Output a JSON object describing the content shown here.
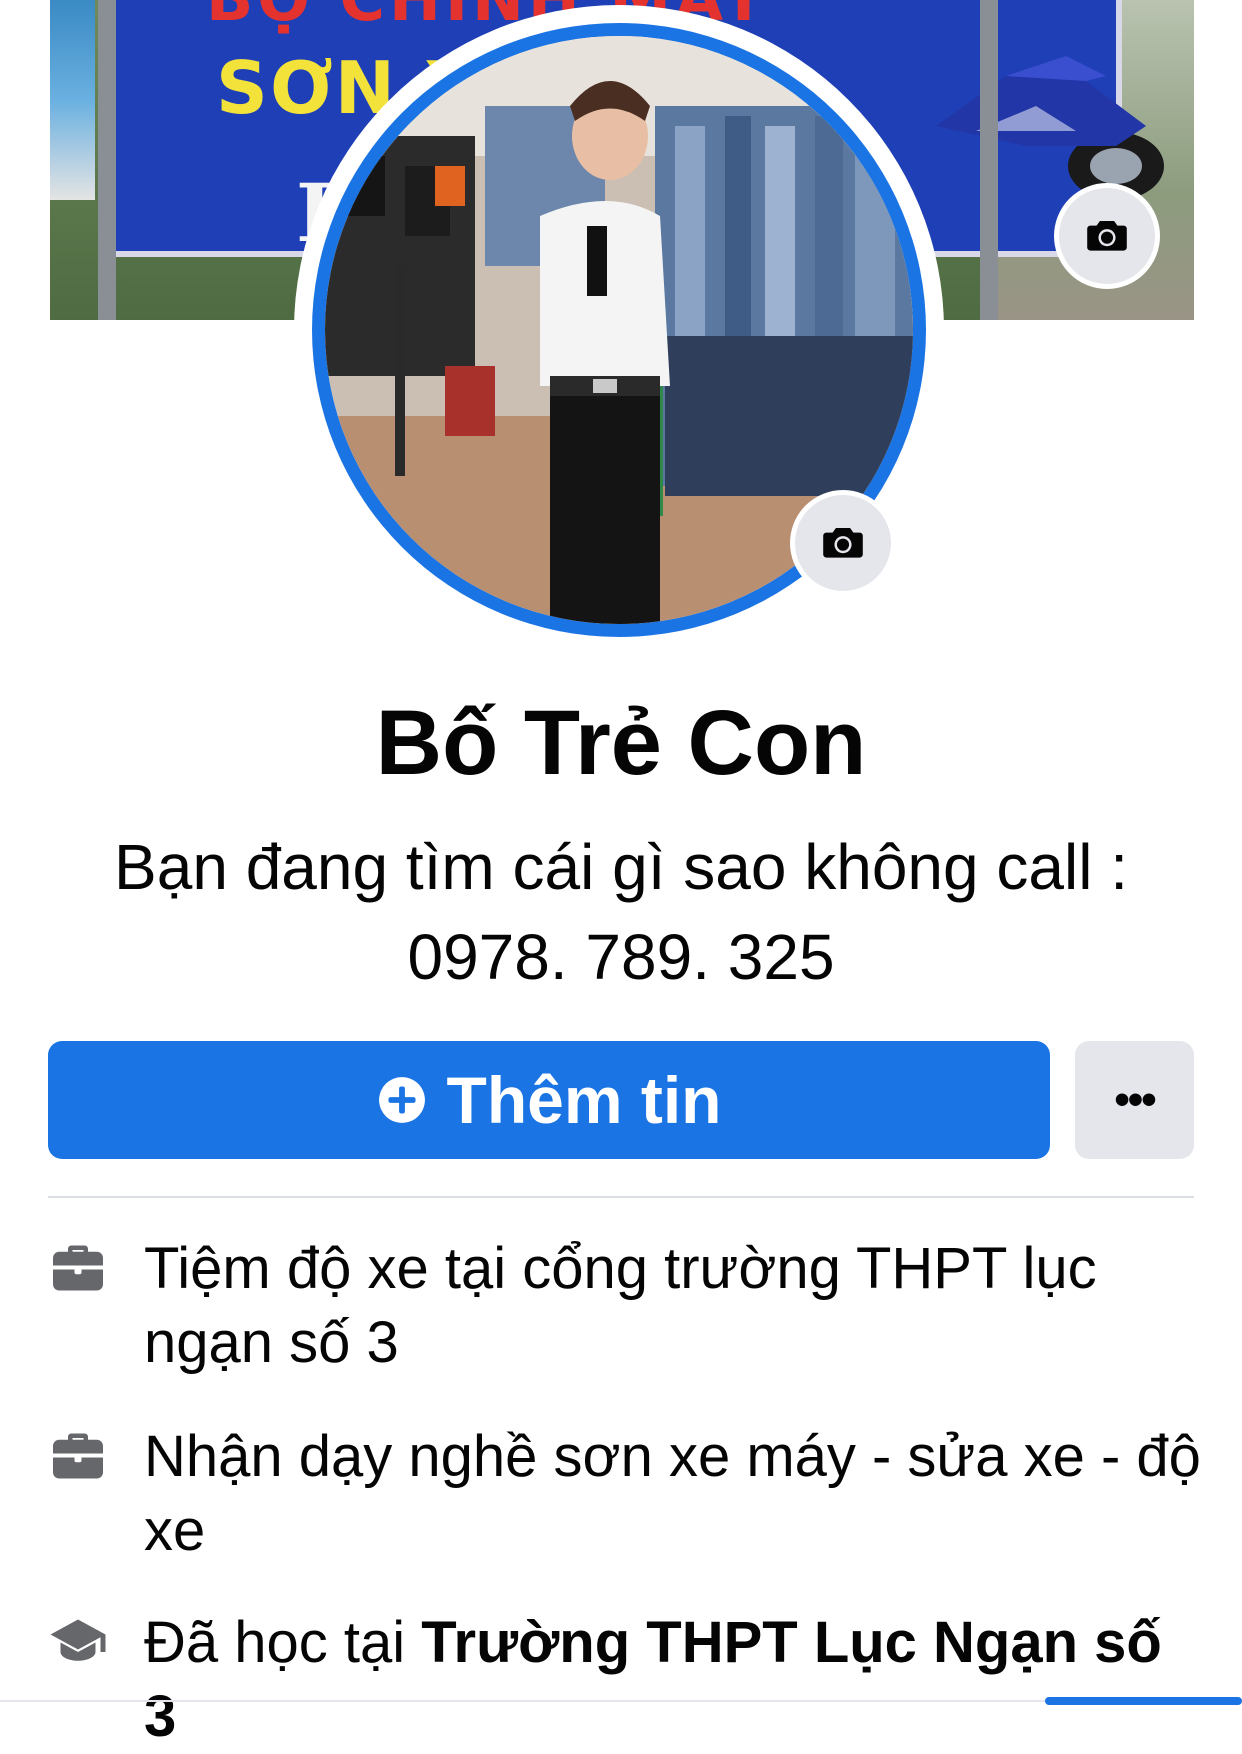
{
  "profile": {
    "name": "Bố Trẻ Con",
    "bio_line_1": "Bạn đang tìm cái gì sao không call :",
    "bio_line_2": "0978. 789. 325"
  },
  "cover": {
    "sign_top_text": "BỘ CHỈNH MÁY",
    "sign_text_1": "SƠN XE",
    "sign_text_2": "LÀ"
  },
  "actions": {
    "primary_label": "Thêm tin",
    "primary_icon": "plus-circle-icon",
    "more_label": "•••"
  },
  "intro": {
    "items": [
      {
        "icon": "briefcase-icon",
        "text": "Tiệm độ xe tại cổng trường THPT lục ngạn số 3"
      },
      {
        "icon": "briefcase-icon",
        "text": "Nhận dạy nghề sơn xe máy - sửa xe - độ xe"
      },
      {
        "icon": "graduation-cap-icon",
        "prefix": "Đã học tại ",
        "bold": "Trường THPT Lục Ngạn số 3"
      }
    ]
  },
  "colors": {
    "accent": "#1b74e4",
    "button_gray": "#e4e6eb",
    "text": "#050505",
    "icon_gray": "#65676b"
  }
}
